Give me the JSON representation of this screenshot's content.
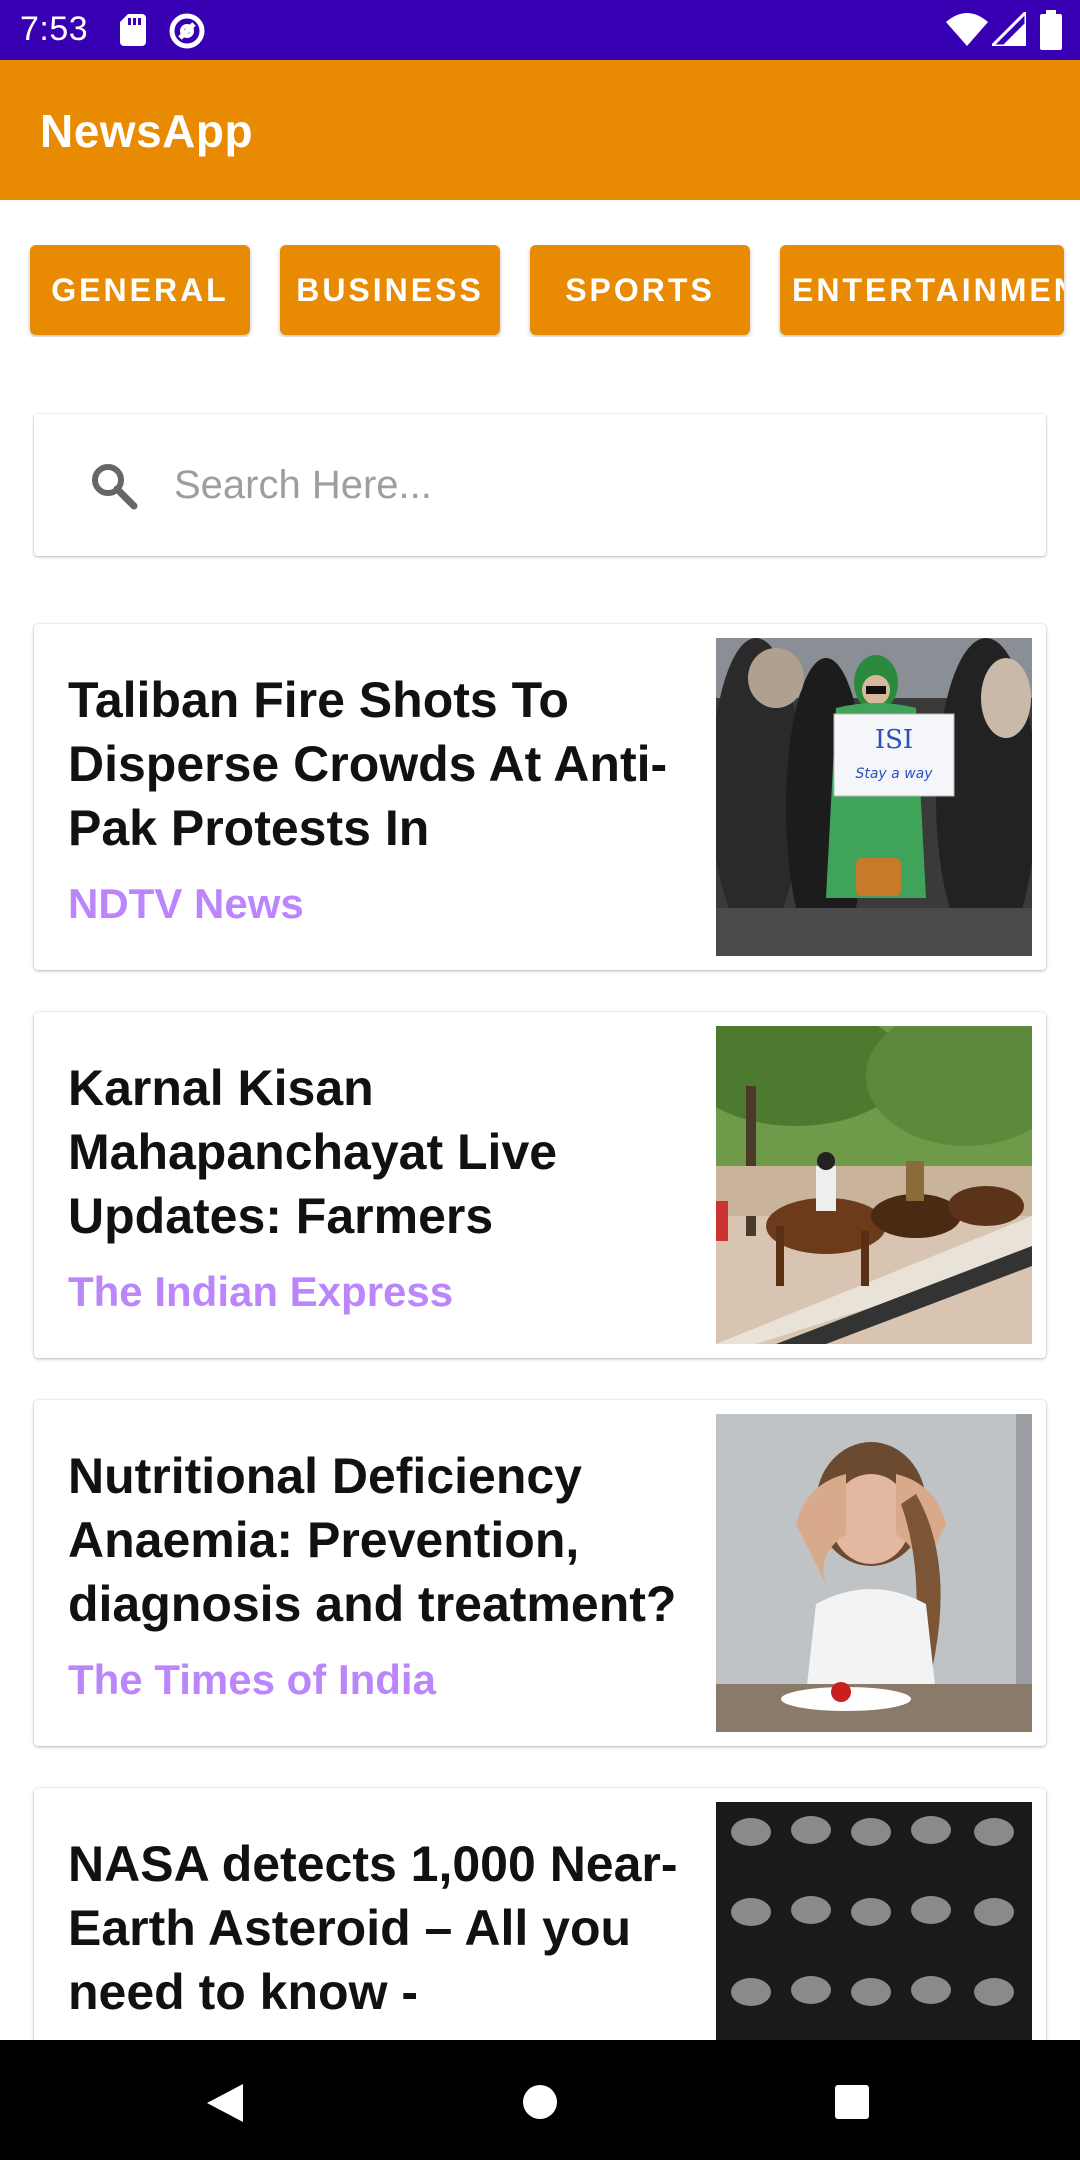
{
  "status_bar": {
    "time": "7:53",
    "background": "#3700B3",
    "icons": [
      "sd-card-icon",
      "at-sign-icon",
      "wifi-icon",
      "signal-icon",
      "battery-icon"
    ]
  },
  "app_bar": {
    "title": "NewsApp",
    "background": "#E98B02"
  },
  "categories": [
    {
      "label": "GENERAL"
    },
    {
      "label": "BUSINESS"
    },
    {
      "label": "SPORTS"
    },
    {
      "label": "ENTERTAINMENT"
    }
  ],
  "search": {
    "placeholder": "Search Here...",
    "value": "",
    "icon": "search-icon"
  },
  "news": [
    {
      "title": "Taliban Fire Shots To Disperse Crowds At Anti-Pak Protests In",
      "source": "NDTV News",
      "image_sign_text": [
        "ISI",
        "Stay a way"
      ]
    },
    {
      "title": "Karnal Kisan Mahapanchayat Live Updates: Farmers",
      "source": "The Indian Express"
    },
    {
      "title": "Nutritional Deficiency Anaemia: Prevention, diagnosis and treatment?",
      "source": "The Times of India"
    },
    {
      "title": "NASA detects 1,000 Near-Earth Asteroid – All you need to know -",
      "source": ""
    }
  ],
  "colors": {
    "accent": "#E98B02",
    "source_text": "#BB86FC",
    "status_bar": "#3700B3"
  },
  "nav_bar": {
    "icons": [
      "back-icon",
      "home-icon",
      "recents-icon"
    ]
  }
}
